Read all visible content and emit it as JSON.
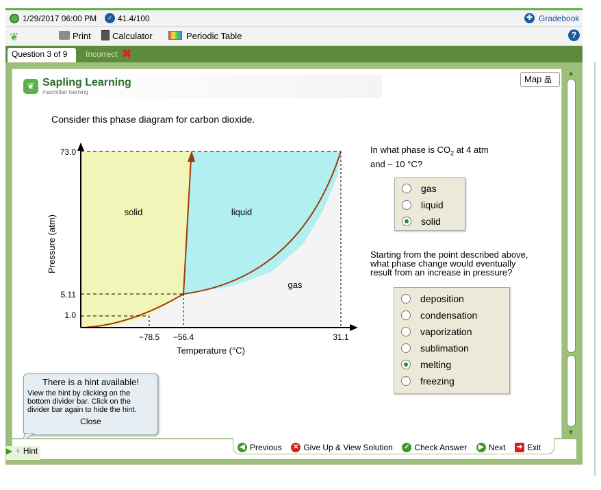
{
  "topbar": {
    "timestamp": "1/29/2017 06:00 PM",
    "score": "41.4/100",
    "gradebook": "Gradebook"
  },
  "toolbar": {
    "print": "Print",
    "calculator": "Calculator",
    "periodic_table": "Periodic Table"
  },
  "tabs": {
    "question": "Question 3 of 9",
    "status": "Incorrect"
  },
  "header": {
    "brand": "Sapling Learning",
    "sub": "macmillan learning",
    "map": "Map"
  },
  "question": {
    "prompt": "Consider this phase diagram for carbon dioxide.",
    "q1_pre": "In what phase is CO",
    "q1_sub": "2",
    "q1_post": " at 4 atm",
    "q1_line2": "and – 10 °C?",
    "q1_options": [
      "gas",
      "liquid",
      "solid"
    ],
    "q1_selected": 2,
    "q2_line1": "Starting from the point described above,",
    "q2_line2": "what phase change would eventually",
    "q2_line3": "result from an increase in pressure?",
    "q2_options": [
      "deposition",
      "condensation",
      "vaporization",
      "sublimation",
      "melting",
      "freezing"
    ],
    "q2_selected": 4
  },
  "chart_data": {
    "type": "phase-diagram",
    "xlabel": "Temperature (°C)",
    "ylabel": "Pressure (atm)",
    "x_ticks": [
      "−78.5",
      "−56.4",
      "31.1"
    ],
    "y_ticks": [
      "73.0",
      "5.11",
      "1.0"
    ],
    "regions": [
      "solid",
      "liquid",
      "gas"
    ],
    "triple_point": {
      "temperature": -56.4,
      "pressure": 5.11
    },
    "critical_point": {
      "temperature": 31.1,
      "pressure": 73.0
    },
    "sublimation_point": {
      "temperature": -78.5,
      "pressure": 1.0
    }
  },
  "hint": {
    "title": "There is a hint available!",
    "line1": "View the hint by clicking on the",
    "line2": "bottom divider bar. Click on the",
    "line3": "divider bar again to hide the hint.",
    "close": "Close",
    "tab": "Hint"
  },
  "nav": {
    "previous": "Previous",
    "give_up": "Give Up & View Solution",
    "check": "Check Answer",
    "next": "Next",
    "exit": "Exit"
  },
  "colors": {
    "solid": "#f2f5b8",
    "liquid": "#b2eff0",
    "gas": "#f4f4f4",
    "curve": "#9c3a0a",
    "frame": "#9dbf79"
  }
}
